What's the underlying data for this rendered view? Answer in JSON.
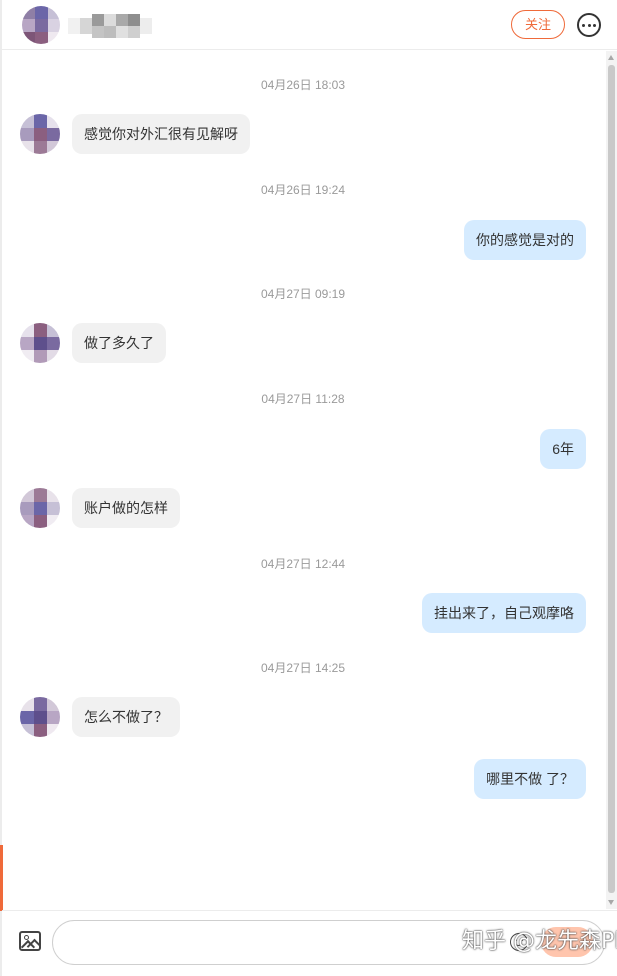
{
  "header": {
    "follow_label": "关注",
    "more_icon": "more-dots-icon"
  },
  "messages": [
    {
      "time": "04月26日 18:03",
      "side": "in",
      "text": "感觉你对外汇很有见解呀"
    },
    {
      "time": "04月26日 19:24",
      "side": "out",
      "text": "你的感觉是对的"
    },
    {
      "time": "04月27日 09:19",
      "side": "in",
      "text": "做了多久了"
    },
    {
      "time": "04月27日 11:28",
      "side": "out",
      "text": "6年"
    },
    {
      "time": "",
      "side": "in",
      "text": "账户做的怎样"
    },
    {
      "time": "04月27日 12:44",
      "side": "out",
      "text": "挂出来了，自己观摩咯"
    },
    {
      "time": "04月27日 14:25",
      "side": "in",
      "text": "怎么不做了？"
    },
    {
      "time": "",
      "side": "out",
      "text": "哪里不做 了？"
    }
  ],
  "input_bar": {
    "image_icon": "image-icon",
    "emoji_icon": "emoji-icon",
    "message_value": "",
    "watermark": "知乎 @龙先森Plus"
  },
  "colors": {
    "accent": "#ef6a3a",
    "incoming_bubble": "#f1f1f1",
    "outgoing_bubble": "#d5ebff",
    "send_button": "#ffc5ad"
  }
}
